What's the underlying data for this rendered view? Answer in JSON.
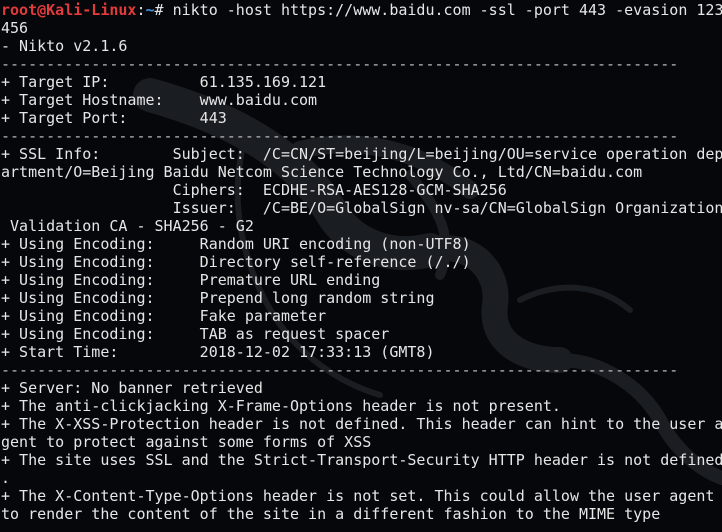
{
  "terminal": {
    "prompt": {
      "user_host": "root@Kali-Linux",
      "separator": ":",
      "cwd": "~",
      "symbol": "#",
      "command": " nikto -host https://www.baidu.com -ssl -port 443 -evasion 123"
    },
    "lines": [
      "456",
      "- Nikto v2.1.6",
      "---------------------------------------------------------------------------",
      "+ Target IP:          61.135.169.121",
      "+ Target Hostname:    www.baidu.com",
      "+ Target Port:        443",
      "---------------------------------------------------------------------------",
      "+ SSL Info:        Subject:  /C=CN/ST=beijing/L=beijing/OU=service operation dep",
      "artment/O=Beijing Baidu Netcom Science Technology Co., Ltd/CN=baidu.com",
      "                   Ciphers:  ECDHE-RSA-AES128-GCM-SHA256",
      "                   Issuer:   /C=BE/O=GlobalSign nv-sa/CN=GlobalSign Organization",
      " Validation CA - SHA256 - G2",
      "+ Using Encoding:     Random URI encoding (non-UTF8)",
      "+ Using Encoding:     Directory self-reference (/./)",
      "+ Using Encoding:     Premature URL ending",
      "+ Using Encoding:     Prepend long random string",
      "+ Using Encoding:     Fake parameter",
      "+ Using Encoding:     TAB as request spacer",
      "+ Start Time:         2018-12-02 17:33:13 (GMT8)",
      "---------------------------------------------------------------------------",
      "+ Server: No banner retrieved",
      "+ The anti-clickjacking X-Frame-Options header is not present.",
      "+ The X-XSS-Protection header is not defined. This header can hint to the user a",
      "gent to protect against some forms of XSS",
      "+ The site uses SSL and the Strict-Transport-Security HTTP header is not defined",
      ".",
      "+ The X-Content-Type-Options header is not set. This could allow the user agent",
      "to render the content of the site in a different fashion to the MIME type"
    ]
  },
  "colors": {
    "background": "#05070a",
    "text": "#e6e6e6",
    "prompt_user": "#e23b3b",
    "prompt_path": "#4a8fd8",
    "dragon_watermark": "#1a1d22"
  }
}
